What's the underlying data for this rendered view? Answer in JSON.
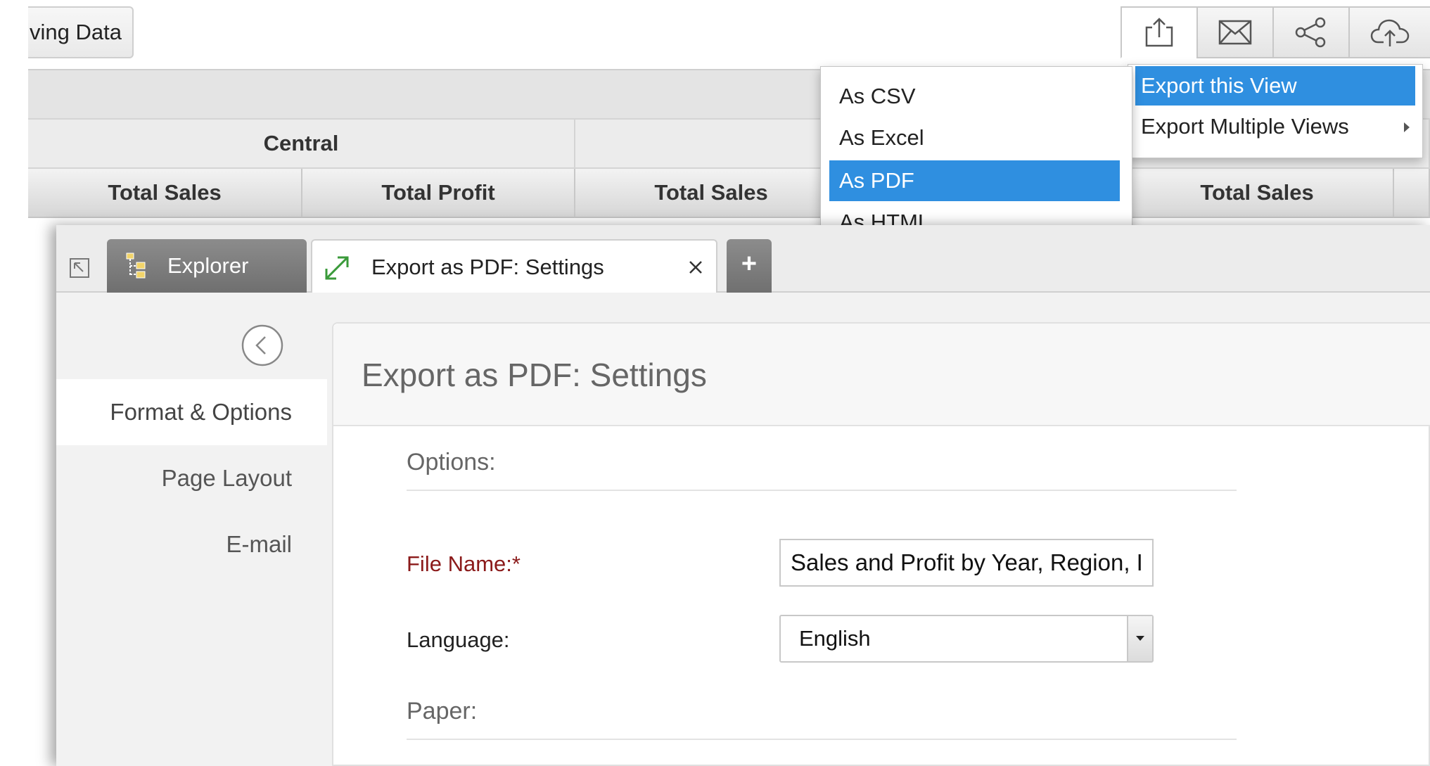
{
  "top_button": {
    "label": "ving Data"
  },
  "table": {
    "group_headers": [
      "Central",
      ""
    ],
    "column_headers": [
      "Total Sales",
      "Total Profit",
      "Total Sales",
      "Total Sales"
    ]
  },
  "toolbar": {
    "buttons": [
      {
        "name": "export",
        "icon": "upload-icon"
      },
      {
        "name": "email",
        "icon": "mail-icon"
      },
      {
        "name": "share",
        "icon": "share-icon"
      },
      {
        "name": "publish",
        "icon": "cloud-upload-icon"
      }
    ]
  },
  "export_menu": {
    "items": [
      {
        "label": "Export this View",
        "selected": true
      },
      {
        "label": "Export Multiple Views",
        "has_submenu": true
      }
    ]
  },
  "format_menu": {
    "items": [
      {
        "label": "As CSV"
      },
      {
        "label": "As Excel"
      },
      {
        "label": "As PDF",
        "selected": true
      },
      {
        "label": "As HTML"
      }
    ]
  },
  "tabs": {
    "explorer_label": "Explorer",
    "export_label": "Export as PDF: Settings",
    "add_label": "+"
  },
  "left_nav": {
    "items": [
      {
        "label": "Format & Options",
        "active": true
      },
      {
        "label": "Page Layout"
      },
      {
        "label": "E-mail"
      }
    ]
  },
  "content": {
    "title": "Export as PDF: Settings",
    "options_heading": "Options:",
    "file_name_label": "File Name:",
    "file_name_required": "*",
    "file_name_value": "Sales and Profit by Year, Region, I",
    "language_label": "Language:",
    "language_value": "English",
    "paper_heading": "Paper:"
  },
  "colors": {
    "selection": "#2f8fe0",
    "required_label": "#8b1a1a"
  }
}
